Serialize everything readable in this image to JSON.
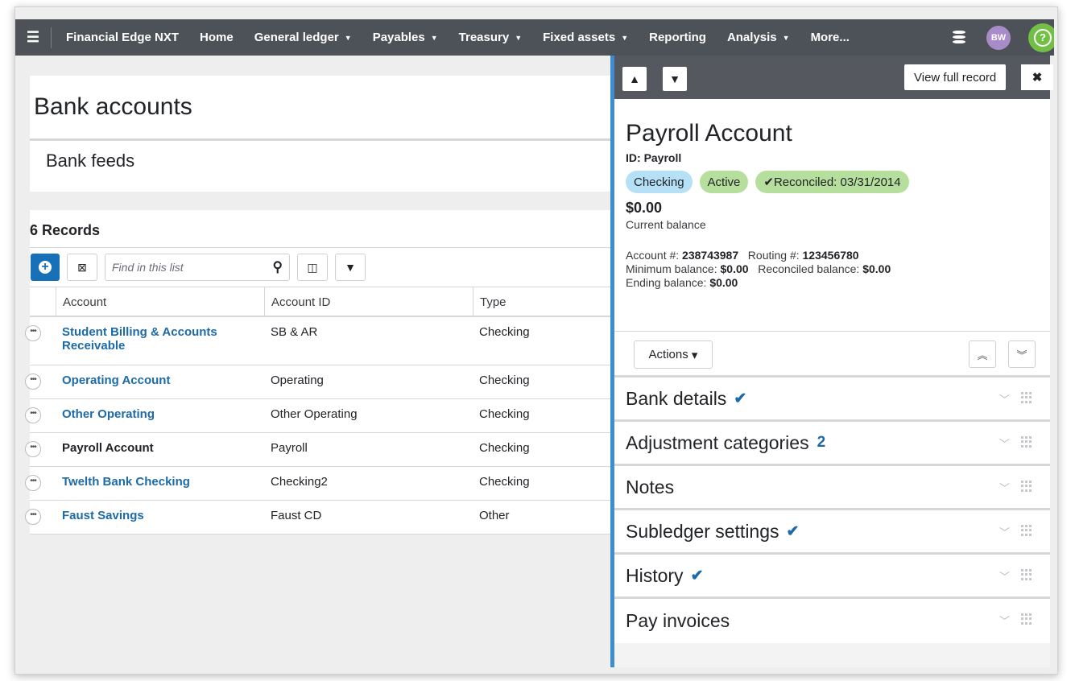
{
  "nav": {
    "menu_icon": "hamburger-icon",
    "brand": "Financial Edge NXT",
    "items": [
      {
        "label": "Home",
        "caret": ""
      },
      {
        "label": "General ledger",
        "caret": "▼"
      },
      {
        "label": "Payables",
        "caret": "▼"
      },
      {
        "label": "Treasury",
        "caret": "▼"
      },
      {
        "label": "Fixed assets",
        "caret": "▼"
      },
      {
        "label": "Reporting",
        "caret": ""
      },
      {
        "label": "Analysis",
        "caret": "▼"
      },
      {
        "label": "More...",
        "caret": ""
      }
    ],
    "avatar": "BW",
    "help": "?",
    "colors": {
      "bar": "#4d5259",
      "avatar": "#a88cc9",
      "help": "#71bf44"
    }
  },
  "page": {
    "title": "Bank accounts",
    "tab": "Bank feeds",
    "records": "6 Records"
  },
  "toolbar": {
    "search_placeholder": "Find in this list",
    "icons": [
      "add-icon",
      "export-excel-icon",
      "search-icon",
      "columns-icon",
      "filter-icon"
    ]
  },
  "table": {
    "columns": [
      "Account",
      "Account ID",
      "Type"
    ],
    "rows": [
      {
        "account": "Student Billing & Accounts Receivable",
        "id": "SB & AR",
        "type": "Checking"
      },
      {
        "account": "Operating Account",
        "id": "Operating",
        "type": "Checking"
      },
      {
        "account": "Other Operating",
        "id": "Other Operating",
        "type": "Checking"
      },
      {
        "account": "Payroll Account",
        "id": "Payroll",
        "type": "Checking"
      },
      {
        "account": "Twelth Bank Checking",
        "id": "Checking2",
        "type": "Checking"
      },
      {
        "account": "Faust Savings",
        "id": "Faust CD",
        "type": "Other"
      }
    ],
    "link_color": "#1c6aa8"
  },
  "panel": {
    "up": "▲",
    "down": "▼",
    "view_full": "View full record",
    "close": "✖",
    "name": "Payroll Account",
    "id_prefix": "ID:",
    "id": "Payroll",
    "badges": [
      {
        "label": "Checking",
        "color": "#b6e0f6"
      },
      {
        "label": "Active",
        "color": "#b6df9d"
      },
      {
        "label": "✔Reconciled: 03/31/2014",
        "color": "#b6df9d"
      }
    ],
    "balance": "$0.00",
    "balance_label": "Current balance",
    "account_no_label": "Account #:",
    "account_no": "238743987",
    "routing_label": "Routing #:",
    "routing": "123456780",
    "min_label": "Minimum balance:",
    "min": "$0.00",
    "rec_label": "Reconciled balance:",
    "rec": "$0.00",
    "end_label": "Ending balance:",
    "end": "$0.00",
    "actions": "Actions",
    "actions_caret": "▾",
    "expand_all": "⌃",
    "collapse_all": "⌄",
    "sections": [
      {
        "label": "Bank details",
        "check": "✔",
        "count": ""
      },
      {
        "label": "Adjustment categories",
        "check": "",
        "count": "2"
      },
      {
        "label": "Notes",
        "check": "",
        "count": ""
      },
      {
        "label": "Subledger settings",
        "check": "✔",
        "count": ""
      },
      {
        "label": "History",
        "check": "✔",
        "count": ""
      },
      {
        "label": "Pay invoices",
        "check": "",
        "count": ""
      }
    ],
    "accent": "#3e8dd2"
  }
}
